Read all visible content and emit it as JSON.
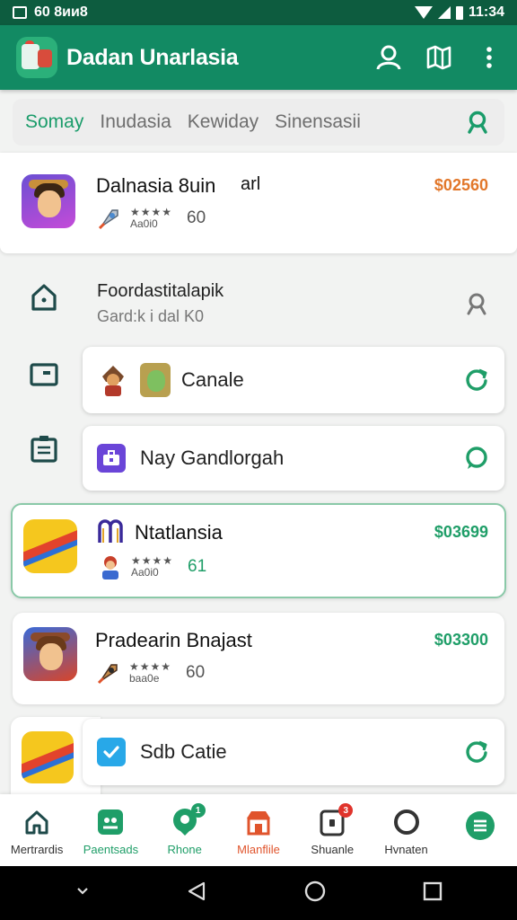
{
  "status_bar": {
    "time_left": "60 8ии8",
    "time_right": "11:34"
  },
  "app_bar": {
    "title": "Dadan Unarlasia"
  },
  "tabs": {
    "items": [
      "Somay",
      "Inudasia",
      "Kewiday",
      "Sinensasii"
    ],
    "active": "Somay"
  },
  "apps": [
    {
      "name": "Dalnasia 8uin",
      "extra": "arl",
      "rating_stars": "★★★★",
      "rating_label": "Aa0i0",
      "count": "60",
      "price": "$02560",
      "price_color": "#e2772a"
    },
    {
      "name": "Ntatlansia",
      "rating_stars": "★★★★",
      "rating_label": "Aa0i0",
      "count": "61",
      "price": "$03699",
      "price_color": "#1f9e68"
    },
    {
      "name": "Pradearin Bnajast",
      "rating_stars": "★★★★",
      "rating_label": "baa0e",
      "count": "60",
      "price": "$03300",
      "price_color": "#1f9e68"
    }
  ],
  "search_row": {
    "title": "Foordastitalapik",
    "subtitle": "Gard:k i dal K0"
  },
  "rows": {
    "canale": "Canale",
    "nay": "Nay Gandlorgah",
    "sdb": "Sdb Catie"
  },
  "bottom_nav": [
    {
      "label": "Mertrardis",
      "color": "#333"
    },
    {
      "label": "Paentsads",
      "color": "#1f9e68"
    },
    {
      "label": "Rhone",
      "color": "#1f9e68",
      "badge": "1"
    },
    {
      "label": "Mlanflile",
      "color": "#e0542c"
    },
    {
      "label": "Shuanle",
      "color": "#333",
      "badge": "3"
    },
    {
      "label": "Hvnaten",
      "color": "#333"
    }
  ],
  "colors": {
    "primary": "#128a63",
    "status_bar": "#0d5c3f",
    "accent": "#1f9e68",
    "orange": "#e2772a"
  }
}
